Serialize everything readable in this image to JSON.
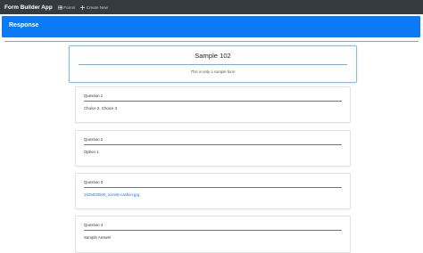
{
  "navbar": {
    "brand": "Form Builder App",
    "links": [
      {
        "label": "Forms",
        "icon": "list-icon"
      },
      {
        "label": "Create New",
        "icon": "plus-icon"
      }
    ]
  },
  "header": {
    "title": "Response"
  },
  "form": {
    "title": "Sample 102",
    "description": "This is only a sample form"
  },
  "questions": [
    {
      "label": "Question 1",
      "answer": "Choice 2, Choice 3"
    },
    {
      "label": "Question 2",
      "answer": "Option 1"
    },
    {
      "label": "Question 3",
      "answer": "1625033940_icons8-cashier.jpg"
    },
    {
      "label": "Question 4",
      "answer": "Sample Answer"
    }
  ],
  "colors": {
    "navbar": "#343a40",
    "primary": "#0a7bf5",
    "link": "#1a73e8"
  }
}
